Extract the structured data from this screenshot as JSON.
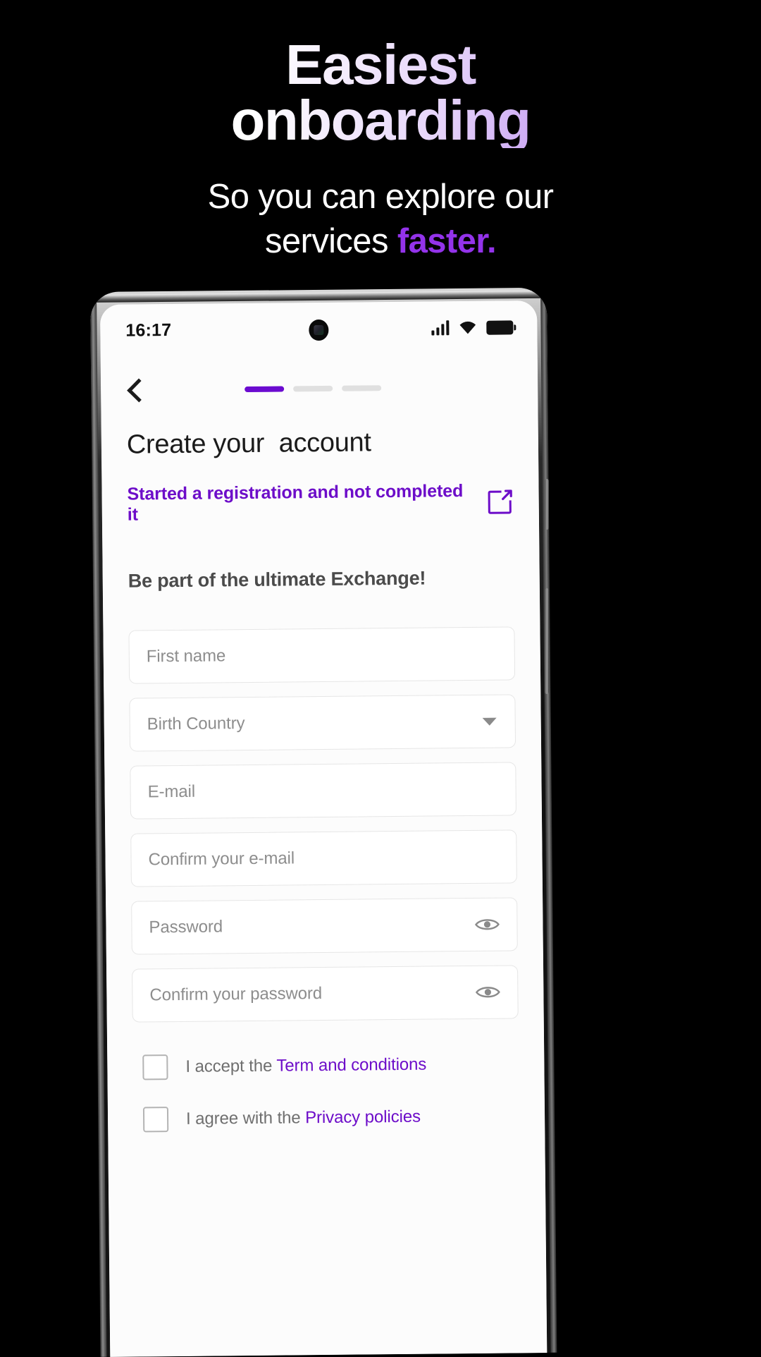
{
  "promo": {
    "title_line1": "Easiest",
    "title_line2": "onboarding",
    "subtitle_line1": "So you can explore our",
    "subtitle_line2_plain": "services ",
    "subtitle_line2_accent": "faster.",
    "gradient_start": "#ffffff",
    "gradient_end": "#a45ceb",
    "accent_color": "#9333ea",
    "background_color": "#000000"
  },
  "phone": {
    "statusbar": {
      "time": "16:17",
      "icons": [
        "signal-icon",
        "wifi-icon",
        "battery-icon"
      ]
    },
    "header": {
      "back_icon": "chevron-left-icon",
      "progress": {
        "total_steps": 3,
        "active_step": 1,
        "active_color": "#6b0bd0",
        "inactive_color": "#e0e0e0"
      }
    },
    "screen": {
      "page_title": "Create your  account",
      "resume_link": "Started a registration and not completed it",
      "resume_link_icon": "external-link-icon",
      "resume_link_color": "#6d0dc9",
      "tagline": "Be part of the ultimate Exchange!",
      "fields": [
        {
          "placeholder": "First name",
          "type": "text",
          "trailing_icon": ""
        },
        {
          "placeholder": "Birth Country",
          "type": "select",
          "trailing_icon": "chevron-down-icon"
        },
        {
          "placeholder": "E-mail",
          "type": "email",
          "trailing_icon": ""
        },
        {
          "placeholder": "Confirm your e-mail",
          "type": "email",
          "trailing_icon": ""
        },
        {
          "placeholder": "Password",
          "type": "password",
          "trailing_icon": "eye-icon"
        },
        {
          "placeholder": "Confirm your password",
          "type": "password",
          "trailing_icon": "eye-icon"
        }
      ],
      "checkboxes": [
        {
          "text": "I accept the ",
          "link": "Term and conditions",
          "checked": false
        },
        {
          "text": "I agree with the ",
          "link": "Privacy policies",
          "checked": false
        }
      ]
    }
  }
}
